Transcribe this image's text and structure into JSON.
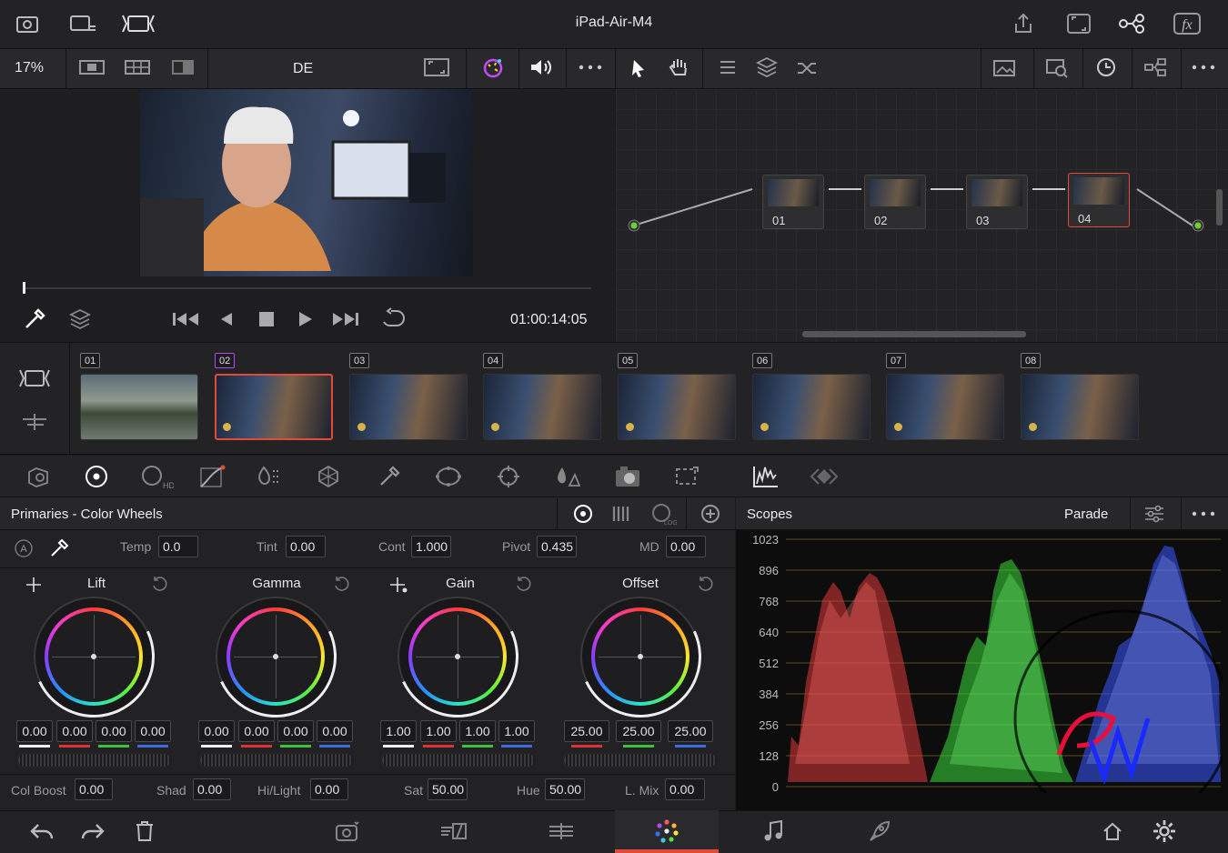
{
  "app": {
    "title": "iPad-Air-M4"
  },
  "toolbar": {
    "zoom": "17%",
    "lang": "DE"
  },
  "transport": {
    "timecode": "01:00:14:05"
  },
  "nodes": [
    {
      "label": "01"
    },
    {
      "label": "02"
    },
    {
      "label": "03"
    },
    {
      "label": "04"
    }
  ],
  "clips": [
    "01",
    "02",
    "03",
    "04",
    "05",
    "06",
    "07",
    "08"
  ],
  "primaries": {
    "title": "Primaries - Color Wheels",
    "temp_label": "Temp",
    "temp": "0.0",
    "tint_label": "Tint",
    "tint": "0.00",
    "cont_label": "Cont",
    "cont": "1.000",
    "pivot_label": "Pivot",
    "pivot": "0.435",
    "md_label": "MD",
    "md": "0.00",
    "wheels": [
      {
        "name": "Lift",
        "values": [
          "0.00",
          "0.00",
          "0.00",
          "0.00"
        ]
      },
      {
        "name": "Gamma",
        "values": [
          "0.00",
          "0.00",
          "0.00",
          "0.00"
        ]
      },
      {
        "name": "Gain",
        "values": [
          "1.00",
          "1.00",
          "1.00",
          "1.00"
        ]
      },
      {
        "name": "Offset",
        "values": [
          "25.00",
          "25.00",
          "25.00"
        ]
      }
    ],
    "colboost_label": "Col Boost",
    "colboost": "0.00",
    "shad_label": "Shad",
    "shad": "0.00",
    "hilight_label": "Hi/Light",
    "hilight": "0.00",
    "sat_label": "Sat",
    "sat": "50.00",
    "hue_label": "Hue",
    "hue": "50.00",
    "lmix_label": "L. Mix",
    "lmix": "0.00"
  },
  "scopes": {
    "title": "Scopes",
    "mode": "Parade",
    "y_ticks": [
      "1023",
      "896",
      "768",
      "640",
      "512",
      "384",
      "256",
      "128",
      "0"
    ]
  },
  "colors": {
    "accent": "#e24b3b",
    "selected_clip": "#b04aff"
  }
}
